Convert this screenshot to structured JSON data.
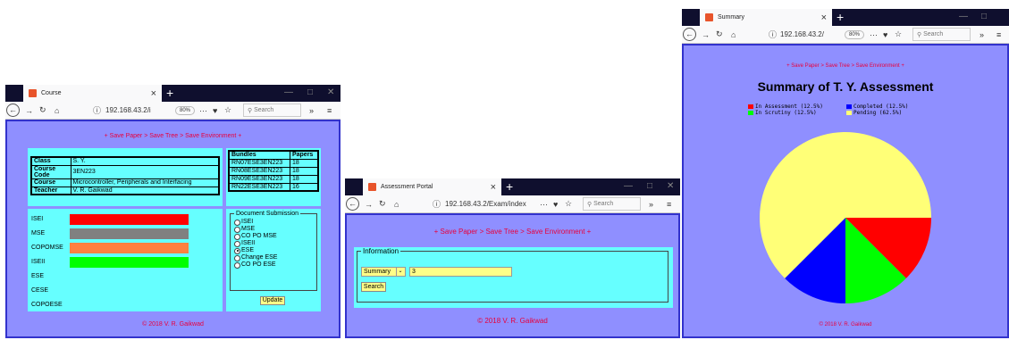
{
  "windows": {
    "course": {
      "tab_title": "Course",
      "url": "192.168.43.2/i",
      "zoom": "80%",
      "search_placeholder": "Search",
      "breadcrumb": "+ Save Paper > Save Tree > Save Environment +",
      "info": [
        {
          "label": "Class",
          "value": "S. Y."
        },
        {
          "label": "Course Code",
          "value": "3EN223"
        },
        {
          "label": "Course",
          "value": "Microcontroller, Peripherals and Interfacing"
        },
        {
          "label": "Teacher",
          "value": "V. R. Gaikwad"
        }
      ],
      "bundles_header": [
        "Bundles",
        "Papers"
      ],
      "bundles": [
        [
          "RN07ESE3EN223",
          "18"
        ],
        [
          "RN08ESE3EN223",
          "18"
        ],
        [
          "RN09ESE3EN223",
          "18"
        ],
        [
          "RN22ESE3EN223",
          "16"
        ]
      ],
      "exams": [
        {
          "label": "ISEI",
          "color": "#ff0000"
        },
        {
          "label": "MSE",
          "color": "#808080"
        },
        {
          "label": "COPOMSE",
          "color": "#ff8040"
        },
        {
          "label": "ISEII",
          "color": "#00ff00"
        },
        {
          "label": "ESE",
          "color": ""
        },
        {
          "label": "CESE",
          "color": ""
        },
        {
          "label": "COPOESE",
          "color": ""
        }
      ],
      "submission_legend": "Document Submission",
      "submission_options": [
        {
          "label": "ISEI",
          "checked": false
        },
        {
          "label": "MSE",
          "checked": false
        },
        {
          "label": "CO PO MSE",
          "checked": false
        },
        {
          "label": "ISEII",
          "checked": false
        },
        {
          "label": "ESE",
          "checked": true
        },
        {
          "label": "Change ESE",
          "checked": false
        },
        {
          "label": "CO PO ESE",
          "checked": false
        }
      ],
      "update_label": "Update",
      "footer": "© 2018 V. R. Gaikwad"
    },
    "portal": {
      "tab_title": "Assessment Portal",
      "url": "192.168.43.2/Exam/index",
      "search_placeholder": "Search",
      "breadcrumb": "+ Save Paper > Save Tree > Save Environment +",
      "legend": "Information",
      "select_value": "Summary",
      "input_value": "3",
      "search_button": "Search",
      "footer": "© 2018 V. R. Gaikwad"
    },
    "summary": {
      "tab_title": "Summary",
      "url": "192.168.43.2/",
      "zoom": "80%",
      "search_placeholder": "Search",
      "breadcrumb": "+ Save Paper > Save Tree > Save Environment +",
      "footer": "© 2018 V. R. Gaikwad"
    }
  },
  "chart_data": {
    "type": "pie",
    "title": "Summary of T. Y. Assessment",
    "series": [
      {
        "name": "In Assessment  (12.5%)",
        "value": 12.5,
        "color": "#ff0000"
      },
      {
        "name": "Completed  (12.5%)",
        "value": 12.5,
        "color": "#0000ff"
      },
      {
        "name": "In Scrutiny  (12.5%)",
        "value": 12.5,
        "color": "#00ff00"
      },
      {
        "name": "Pending  (62.5%)",
        "value": 62.5,
        "color": "#ffff77"
      }
    ],
    "legend_position": "top"
  }
}
